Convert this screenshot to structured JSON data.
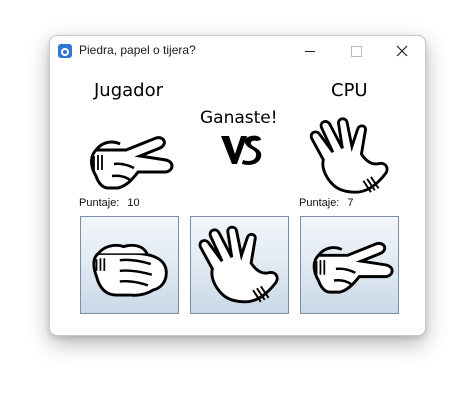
{
  "window": {
    "title": "Piedra, papel o tijera?",
    "app_icon": "game-icon",
    "controls": [
      "minimize-icon",
      "maximize-icon",
      "close-icon"
    ]
  },
  "player": {
    "label": "Jugador",
    "hand_icon": "scissors-hand-icon",
    "score_label": "Puntaje:",
    "score_value": "10"
  },
  "cpu": {
    "label": "CPU",
    "hand_icon": "paper-hand-icon",
    "score_label": "Puntaje:",
    "score_value": "7"
  },
  "result_text": "Ganaste!",
  "vs_text": "VS",
  "choices": [
    {
      "name": "piedra",
      "icon": "rock-hand-icon"
    },
    {
      "name": "papel",
      "icon": "paper-hand-icon"
    },
    {
      "name": "tijera",
      "icon": "scissors-hand-icon"
    }
  ],
  "colors": {
    "button_border": "#7a8fa6",
    "button_gradient_top": "#f2f6fa",
    "button_gradient_bottom": "#c9d8e7",
    "hand_outline": "#000000",
    "hand_fill": "#ffffff"
  }
}
